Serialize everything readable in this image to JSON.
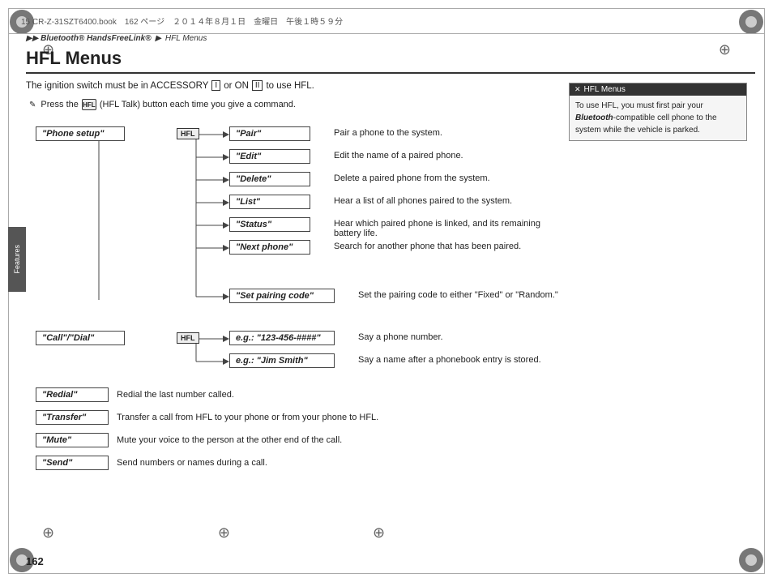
{
  "page": {
    "number": "162",
    "header_text": "15 CR-Z-31SZT6400.book　162 ページ　２０１４年８月１日　金曜日　午後１時５９分"
  },
  "breadcrumb": {
    "parts": [
      "Bluetooth® HandsFreeLink®",
      "HFL Menus"
    ]
  },
  "title": "HFL Menus",
  "ignition_note": "The ignition switch must be in ACCESSORY",
  "ignition_key1": "I",
  "ignition_or": "or ON",
  "ignition_key2": "II",
  "ignition_end": "to use HFL.",
  "info_box": {
    "header": "HFL Menus",
    "body": "To use HFL, you must first pair your Bluetooth-compatible cell phone to the system while the vehicle is parked."
  },
  "hfl_note": "(HFL Talk) button each time you give a command.",
  "press_text": "Press the",
  "phone_setup": {
    "label": "\"Phone setup\"",
    "hfl_icon": "HFL",
    "commands": [
      {
        "label": "\"Pair\"",
        "desc": "Pair a phone to the system."
      },
      {
        "label": "\"Edit\"",
        "desc": "Edit the name of a paired phone."
      },
      {
        "label": "\"Delete\"",
        "desc": "Delete a paired phone from the system."
      },
      {
        "label": "\"List\"",
        "desc": "Hear a list of all phones paired to the system."
      },
      {
        "label": "\"Status\"",
        "desc": "Hear which paired phone is linked, and its remaining battery life."
      },
      {
        "label": "\"Next phone\"",
        "desc": "Search for another phone that has been paired."
      },
      {
        "label": "\"Set pairing code\"",
        "desc": "Set the pairing code to either \"Fixed\" or \"Random.\""
      }
    ]
  },
  "call_dial": {
    "label": "\"Call\"/\"Dial\"",
    "hfl_icon": "HFL",
    "commands": [
      {
        "label": "e.g.: \"123-456-####\"",
        "desc": "Say a phone number."
      },
      {
        "label": "e.g.: \"Jim Smith\"",
        "desc": "Say a name after a phonebook entry is stored."
      }
    ]
  },
  "simple_commands": [
    {
      "label": "\"Redial\"",
      "desc": "Redial the last number called."
    },
    {
      "label": "\"Transfer\"",
      "desc": "Transfer a call from HFL to your phone or from your phone to HFL."
    },
    {
      "label": "\"Mute\"",
      "desc": "Mute your voice to the person at the other end of the call."
    },
    {
      "label": "\"Send\"",
      "desc": "Send numbers or names during a call."
    }
  ],
  "side_tab": "Features"
}
